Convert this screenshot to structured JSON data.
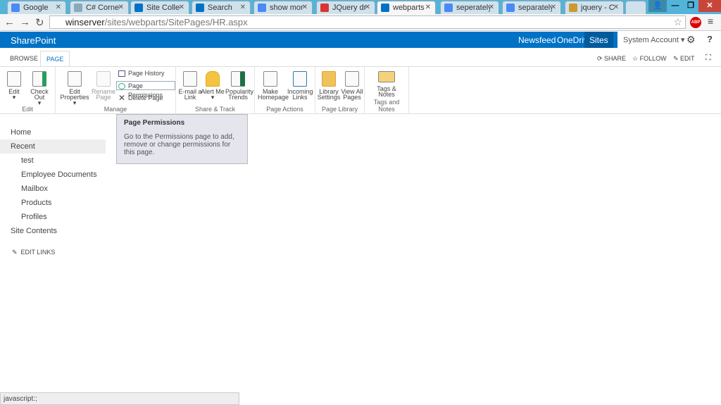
{
  "browser": {
    "tabs": [
      {
        "title": "Google",
        "icon": "google-icon",
        "color": "#4a8af4"
      },
      {
        "title": "C# Corner -",
        "icon": "csharp-corner-icon",
        "color": "#8ab"
      },
      {
        "title": "Site Collecti",
        "icon": "sharepoint-icon",
        "color": "#0072c6"
      },
      {
        "title": "Search",
        "icon": "sharepoint-icon",
        "color": "#0072c6"
      },
      {
        "title": "show montl",
        "icon": "google-icon",
        "color": "#4a8af4"
      },
      {
        "title": "JQuery drop",
        "icon": "as-icon",
        "color": "#d33"
      },
      {
        "title": "webparts -",
        "icon": "sharepoint-icon",
        "color": "#0072c6"
      },
      {
        "title": "seperately l",
        "icon": "google-icon",
        "color": "#4a8af4"
      },
      {
        "title": "separately l",
        "icon": "google-icon",
        "color": "#4a8af4"
      },
      {
        "title": "jquery - Cre",
        "icon": "stackoverflow-icon",
        "color": "#c93"
      }
    ],
    "active_tab": 6,
    "url_host": "winserver",
    "url_path": "/sites/webparts/SitePages/HR.aspx",
    "abp": "ABP"
  },
  "suite": {
    "brand": "SharePoint",
    "links": [
      "Newsfeed",
      "OneDrive",
      "Sites"
    ],
    "account": "System Account ▾",
    "settings": "⚙",
    "help": "?"
  },
  "ribbon_tabs": [
    "BROWSE",
    "PAGE"
  ],
  "actions": {
    "share": "SHARE",
    "follow": "FOLLOW",
    "edit": "EDIT"
  },
  "groups": {
    "edit": {
      "label": "Edit",
      "buttons": [
        "Edit",
        "Check Out"
      ]
    },
    "manage": {
      "label": "Manage",
      "buttons": [
        "Edit Properties ▾",
        "Rename Page"
      ],
      "small": [
        "Page History",
        "Page Permissions",
        "Delete Page"
      ]
    },
    "share": {
      "label": "Share & Track",
      "buttons": [
        "E-mail a Link",
        "Alert Me ▾",
        "Popularity Trends"
      ]
    },
    "actions": {
      "label": "Page Actions",
      "buttons": [
        "Make Homepage",
        "Incoming Links"
      ]
    },
    "library": {
      "label": "Page Library",
      "buttons": [
        "Library Settings",
        "View All Pages"
      ]
    },
    "tags": {
      "label": "Tags and Notes",
      "buttons": [
        "Tags & Notes"
      ]
    }
  },
  "tooltip": {
    "title": "Page Permissions",
    "body": "Go to the Permissions page to add, remove or change permissions for this page."
  },
  "leftnav": {
    "items": [
      "Home",
      "Recent",
      "test",
      "Employee Documents",
      "Mailbox",
      "Products",
      "Profiles",
      "Site Contents"
    ],
    "edit_links": "EDIT LINKS"
  },
  "status": "javascript:;"
}
